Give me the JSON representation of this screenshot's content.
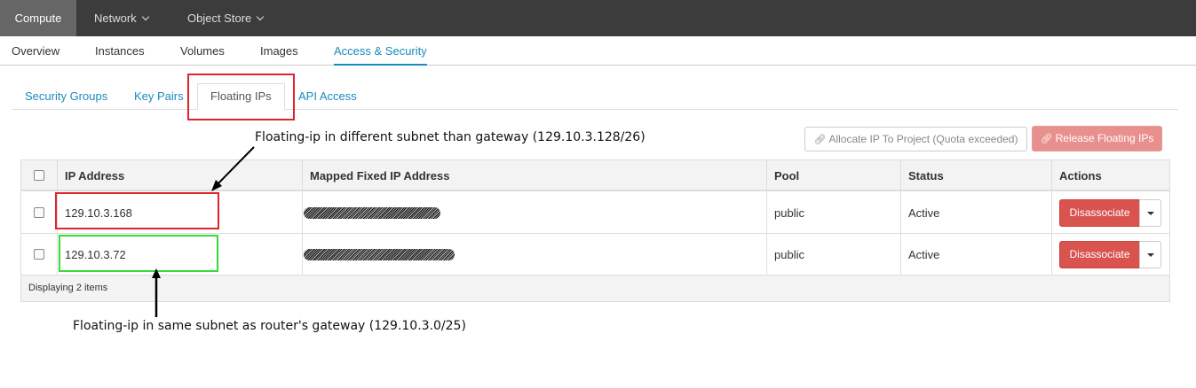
{
  "topnav": {
    "items": [
      {
        "label": "Compute"
      },
      {
        "label": "Network"
      },
      {
        "label": "Object Store"
      }
    ]
  },
  "subnav": {
    "items": [
      {
        "label": "Overview"
      },
      {
        "label": "Instances"
      },
      {
        "label": "Volumes"
      },
      {
        "label": "Images"
      },
      {
        "label": "Access & Security"
      }
    ]
  },
  "tabs": [
    {
      "label": "Security Groups"
    },
    {
      "label": "Key Pairs"
    },
    {
      "label": "Floating IPs"
    },
    {
      "label": "API Access"
    }
  ],
  "actions": {
    "allocate_label": "Allocate IP To Project (Quota exceeded)",
    "release_label": "Release Floating IPs"
  },
  "table": {
    "headers": [
      "IP Address",
      "Mapped Fixed IP Address",
      "Pool",
      "Status",
      "Actions"
    ],
    "rows": [
      {
        "ip": "129.10.3.168",
        "pool": "public",
        "status": "Active",
        "action": "Disassociate"
      },
      {
        "ip": "129.10.3.72",
        "pool": "public",
        "status": "Active",
        "action": "Disassociate"
      }
    ],
    "footer": "Displaying 2 items"
  },
  "annotations": {
    "top": "Floating-ip in different subnet than gateway (129.10.3.128/26)",
    "bottom": "Floating-ip in same subnet as router's gateway  (129.10.3.0/25)"
  },
  "colors": {
    "accent": "#1b8bbd",
    "danger": "#d9534f",
    "annotation_red": "#e0242b",
    "annotation_green": "#3ad83a"
  }
}
